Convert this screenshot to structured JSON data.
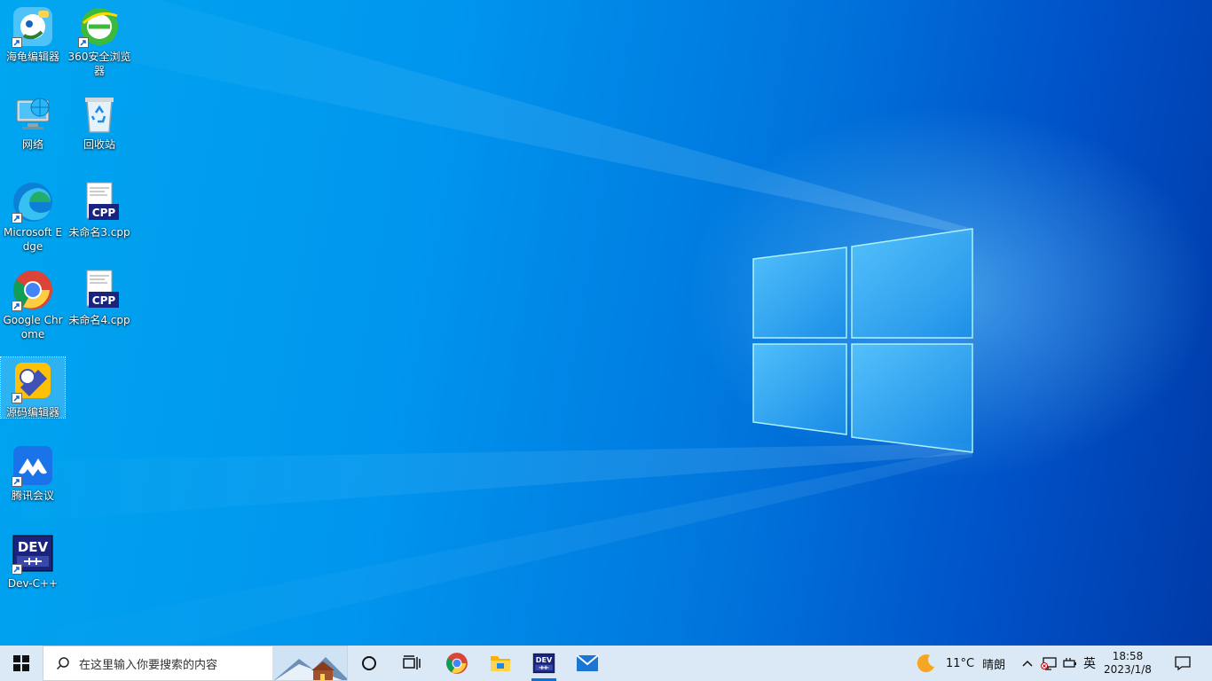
{
  "desktop": {
    "icons": [
      {
        "label": "海龟编辑器",
        "icon": "turtle-editor-icon",
        "shortcut": true
      },
      {
        "label": "360安全浏览器",
        "icon": "360-browser-icon",
        "shortcut": true
      },
      {
        "label": "网络",
        "icon": "network-icon",
        "shortcut": false
      },
      {
        "label": "回收站",
        "icon": "recycle-bin-icon",
        "shortcut": false
      },
      {
        "label": "Microsoft Edge",
        "icon": "edge-icon",
        "shortcut": true
      },
      {
        "label": "未命名3.cpp",
        "icon": "cpp-file-icon",
        "shortcut": false
      },
      {
        "label": "Google Chrome",
        "icon": "chrome-icon",
        "shortcut": true
      },
      {
        "label": "未命名4.cpp",
        "icon": "cpp-file-icon",
        "shortcut": false
      },
      {
        "label": "源码编辑器",
        "icon": "source-code-editor-icon",
        "shortcut": true,
        "selected": true
      },
      {
        "label": "腾讯会议",
        "icon": "tencent-meeting-icon",
        "shortcut": true
      },
      {
        "label": "Dev-C++",
        "icon": "devcpp-icon",
        "shortcut": true
      }
    ],
    "cpp_badge": "CPP",
    "dev_badge": "DEV"
  },
  "taskbar": {
    "start_icon": "windows-start-icon",
    "search_placeholder": "在这里输入你要搜索的内容",
    "pinned": [
      {
        "name": "chrome",
        "icon": "chrome-icon",
        "active": false
      },
      {
        "name": "file-explorer",
        "icon": "folder-icon",
        "active": false
      },
      {
        "name": "dev-cpp",
        "icon": "devcpp-icon",
        "active": true
      },
      {
        "name": "mail",
        "icon": "mail-icon",
        "active": false
      }
    ],
    "tray": {
      "weather_temp": "11°C",
      "weather_desc": "晴朗",
      "input_language": "英",
      "time": "18:58",
      "date": "2023/1/8"
    }
  },
  "colors": {
    "accent": "#0a6fd6",
    "taskbar": "#dbe8f5",
    "desktop_left": "#00a6f0",
    "desktop_right": "#003aa8"
  }
}
